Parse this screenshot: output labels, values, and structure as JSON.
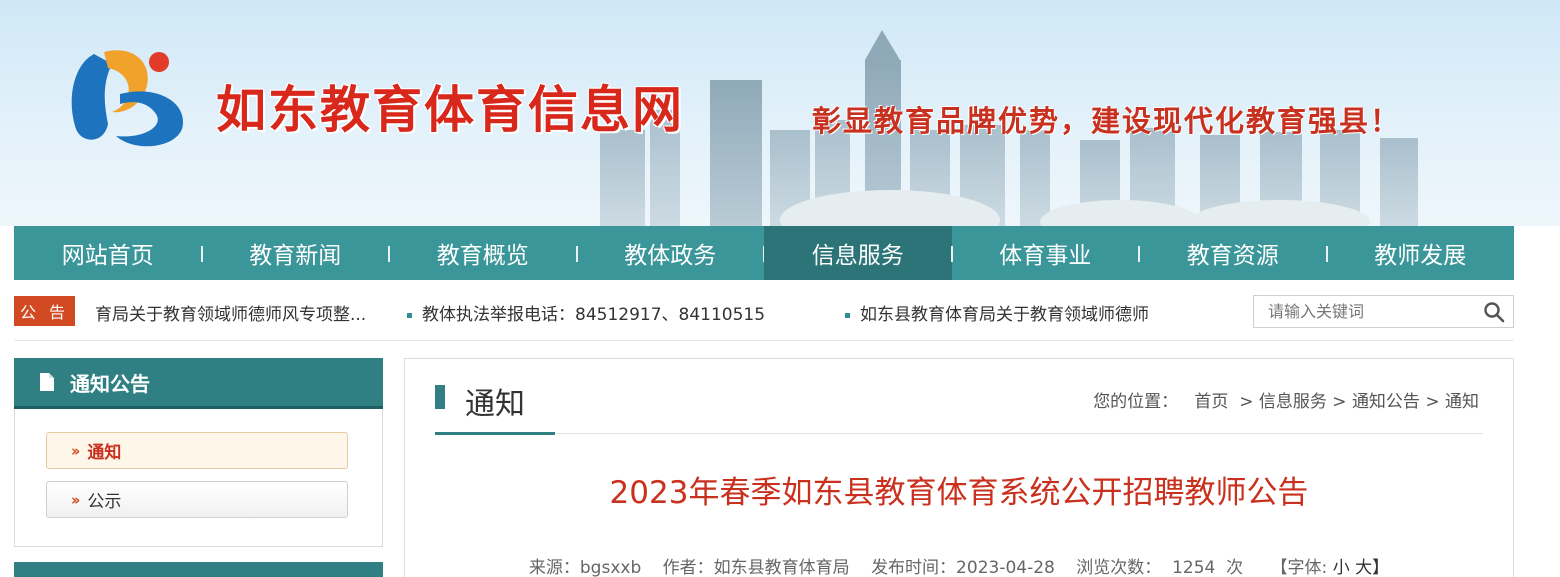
{
  "header": {
    "site_title": "如东教育体育信息网",
    "slogan": "彰显教育品牌优势，建设现代化教育强县！"
  },
  "nav": {
    "items": [
      {
        "label": "网站首页"
      },
      {
        "label": "教育新闻"
      },
      {
        "label": "教育概览"
      },
      {
        "label": "教体政务"
      },
      {
        "label": "信息服务",
        "active": true
      },
      {
        "label": "体育事业"
      },
      {
        "label": "教育资源"
      },
      {
        "label": "教师发展"
      }
    ]
  },
  "notice": {
    "badge": "公 告",
    "items": [
      "育局关于教育领域师德师风专项整...",
      "教体执法举报电话：84512917、84110515",
      "如东县教育体育局关于教育领域师德师"
    ]
  },
  "search": {
    "placeholder": "请输入关键词"
  },
  "sidebar": {
    "title": "通知公告",
    "links": [
      {
        "label": "通知",
        "active": true
      },
      {
        "label": "公示"
      }
    ]
  },
  "main": {
    "section_title": "通知",
    "breadcrumb": {
      "prefix": "您的位置：",
      "items": [
        "首页",
        "信息服务",
        "通知公告",
        "通知"
      ]
    },
    "article_title": "2023年春季如东县教育体育系统公开招聘教师公告",
    "meta": {
      "source": "来源：bgsxxb",
      "author": "作者：如东县教育体育局",
      "published": "发布时间：2023-04-28",
      "views": "浏览次数：  1254  次",
      "font_label": "【字体:",
      "font_small": "小",
      "font_large": "大】"
    }
  },
  "colors": {
    "nav_bg": "#3a9699",
    "nav_active": "#2c7478",
    "title_red": "#c9301d",
    "badge_orange": "#d24a22",
    "teal_dark": "#2f7f83"
  }
}
